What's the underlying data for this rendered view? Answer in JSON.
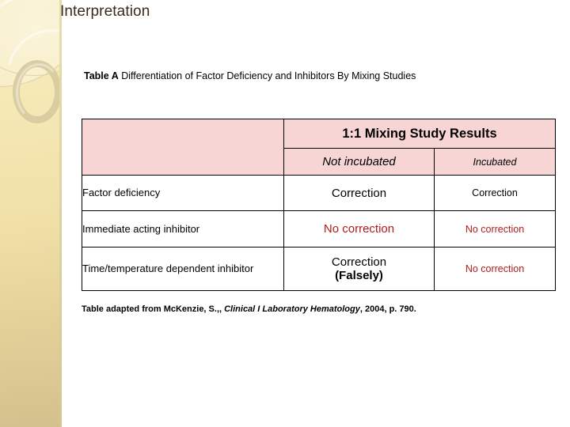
{
  "slide": {
    "title": "Interpretation",
    "title_color": "#3d2b1a"
  },
  "table_caption": {
    "strong": "Table A",
    "rest": " Differentiation of Factor Deficiency and Inhibitors By Mixing Studies"
  },
  "table": {
    "header_bg": "#f7d5d5",
    "group_header": "1:1 Mixing Study Results",
    "corner_blank": "",
    "sub_headers": [
      "Not incubated",
      "Incubated"
    ],
    "rows": [
      {
        "label": "Factor deficiency",
        "not_incubated": "Correction",
        "not_incubated_color": "#000000",
        "incubated": "Correction",
        "incubated_color": "#000000"
      },
      {
        "label": "Immediate acting inhibitor",
        "not_incubated": "No correction",
        "not_incubated_color": "#b01c1c",
        "incubated": "No correction",
        "incubated_color": "#b01c1c"
      },
      {
        "label": "Time/temperature dependent inhibitor",
        "not_incubated": "Correction",
        "not_incubated_second": "(Falsely)",
        "not_incubated_color": "#000000",
        "incubated": "No correction",
        "incubated_color": "#b01c1c"
      }
    ]
  },
  "footnote": {
    "lead": "Table adapted from McKenzie, S.,, ",
    "source_title": "Clinical I Laboratory Hematology",
    "tail": ", 2004, p. 790."
  }
}
